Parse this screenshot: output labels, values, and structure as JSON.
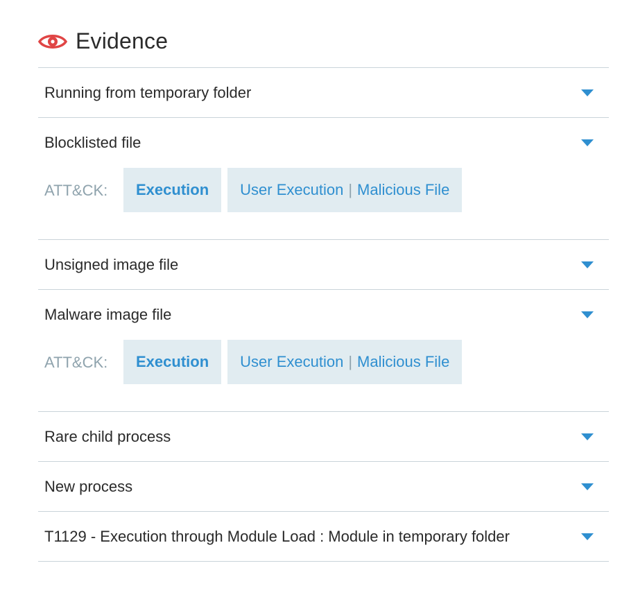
{
  "header": {
    "title": "Evidence",
    "icon": "eye-icon",
    "icon_color": "#e04545"
  },
  "colors": {
    "accent": "#2f8fd0",
    "chip_bg": "#e1ecf1",
    "muted": "#8fa3ad"
  },
  "items": [
    {
      "label": "Running from temporary folder"
    },
    {
      "label": "Blocklisted file",
      "attack": {
        "prefix": "ATT&CK:",
        "tactic": "Execution",
        "technique": "User Execution",
        "separator": "|",
        "subtechnique": "Malicious File"
      }
    },
    {
      "label": "Unsigned image file"
    },
    {
      "label": "Malware image file",
      "attack": {
        "prefix": "ATT&CK:",
        "tactic": "Execution",
        "technique": "User Execution",
        "separator": "|",
        "subtechnique": "Malicious File"
      }
    },
    {
      "label": "Rare child process"
    },
    {
      "label": "New process"
    },
    {
      "label": "T1129 - Execution through Module Load : Module in temporary folder"
    }
  ]
}
